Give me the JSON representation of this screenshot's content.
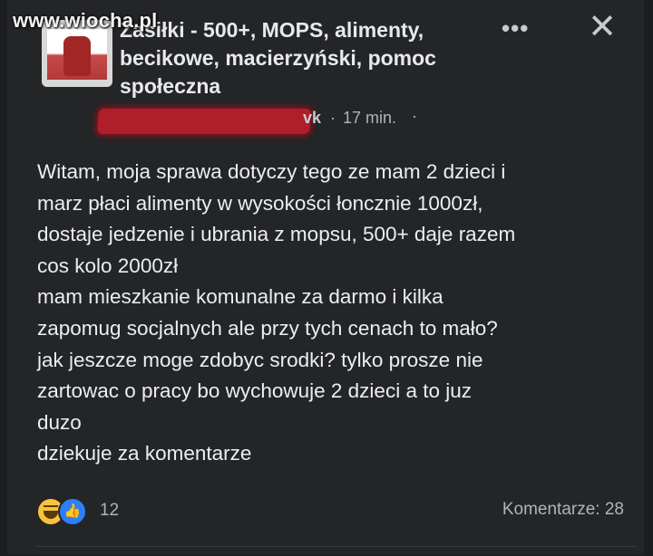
{
  "watermark": "www.wiocha.pl",
  "header": {
    "group_title_line1": "Zasiłki - 500+, MOPS, alimenty,",
    "group_title_line2": "becikowe, macierzyński, pomoc",
    "group_title_line3": "społeczna",
    "more_icon": "more-horizontal-icon",
    "more_symbol": "•••",
    "close_icon": "close-icon",
    "close_symbol": "✕"
  },
  "meta": {
    "author_visible_tail": "vk",
    "separator": "·",
    "time": "17 min.",
    "trailing_dot": "·"
  },
  "post": {
    "text": "Witam, moja sprawa dotyczy tego ze mam 2 dzieci i\nmarz płaci alimenty w wysokości łoncznie 1000zł,\ndostaje jedzenie i ubrania z mopsu, 500+ daje razem\ncos kolo 2000zł\nmam mieszkanie komunalne za darmo i kilka\nzapomug socjalnych ale przy tych cenach to mało?\njak jeszcze moge zdobyc srodki? tylko prosze nie\nzartowac o pracy bo wychowuje 2 dzieci a to juz\nduzo\ndziekuje za komentarze"
  },
  "footer": {
    "reactions": [
      "haha-icon",
      "like-icon"
    ],
    "reaction_count": "12",
    "comments_label": "Komentarze: 28"
  },
  "colors": {
    "background": "#242527",
    "text": "#eceef2",
    "secondary_text": "#b0b3b8",
    "like_blue": "#2d7ff9",
    "haha_yellow": "#f7c33b",
    "redaction_red": "#b01e2a"
  }
}
